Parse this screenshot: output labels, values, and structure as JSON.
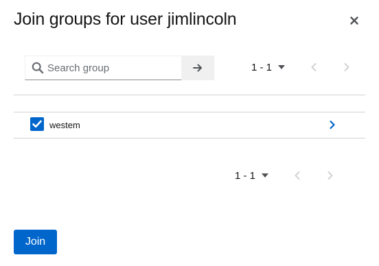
{
  "modal": {
    "title": "Join groups for user jimlincoln"
  },
  "toolbar": {
    "search_placeholder": "Search group",
    "search_value": ""
  },
  "pagination_top": {
    "range": "1 - 1"
  },
  "pagination_bottom": {
    "range": "1 - 1"
  },
  "groups": [
    {
      "name": "westem",
      "checked": true
    }
  ],
  "footer": {
    "join_label": "Join"
  },
  "colors": {
    "primary": "#0066cc",
    "disabled_icon": "#d2d2d2",
    "divider": "#d2d2d2"
  }
}
